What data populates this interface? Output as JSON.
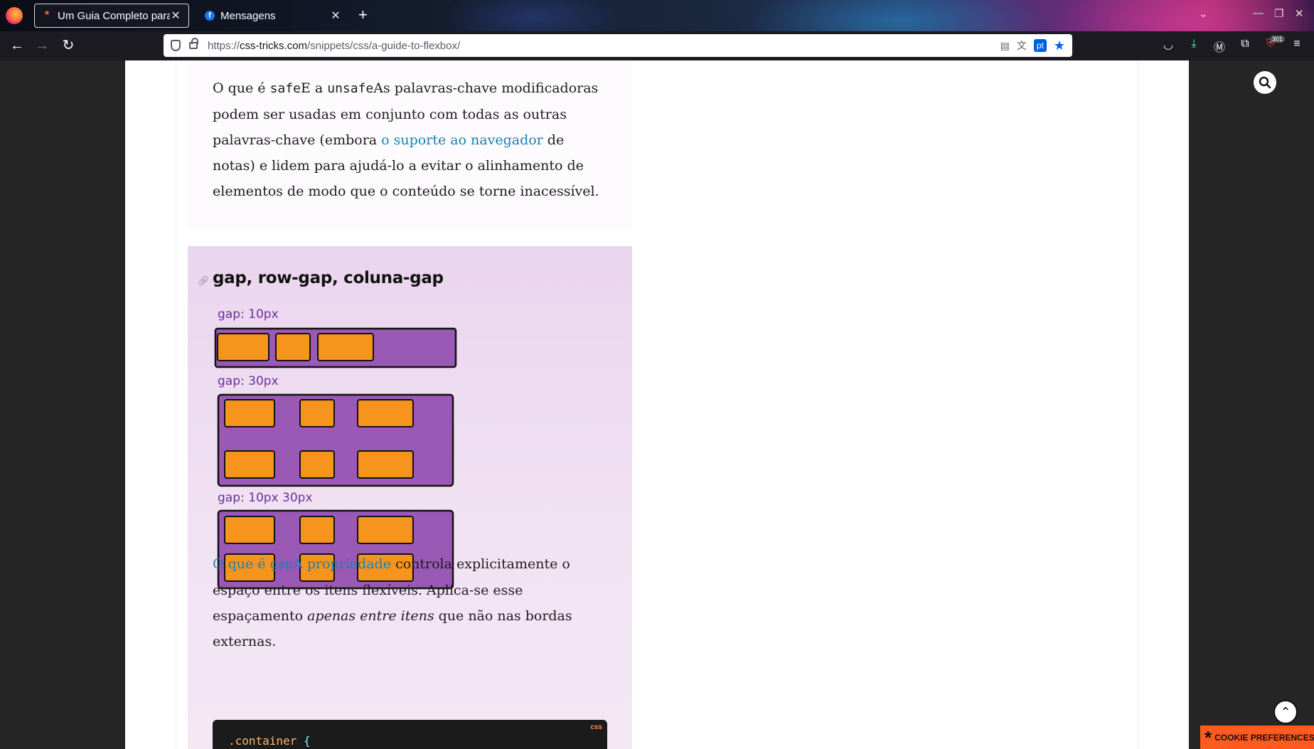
{
  "browser": {
    "tabs": [
      {
        "title": "Um Guia Completo para",
        "favicon": "css-tricks-asterisk-icon"
      },
      {
        "title": "Mensagens",
        "favicon": "facebook-icon"
      }
    ],
    "url": {
      "protocol": "https://",
      "host": "css-tricks.com",
      "path": "/snippets/css/a-guide-to-flexbox/"
    },
    "translate_lang": "pt",
    "extension_badge": "301"
  },
  "article": {
    "p1": {
      "t1": "O que é ",
      "code1": "safe",
      "t2": "E a ",
      "code2": "unsafe",
      "t3": "As palavras-chave modificadoras podem ser usadas em conjunto com todas as outras palavras-chave (embora ",
      "link": "o suporte ao navegador",
      "t4": " de notas) e lidem para ajudá-lo a evitar o alinhamento de elementos de modo que o conteúdo se torne inacessível."
    },
    "heading": "gap, row-gap, coluna-gap",
    "diagram": {
      "labels": [
        "gap: 10px",
        "gap: 30px",
        "gap: 10px 30px"
      ],
      "container_color": "#9b59b6",
      "item_color": "#f7941d"
    },
    "p2": {
      "link1": "O que é ",
      "code": "gap",
      "link2": "A propriedade",
      "t1": " controla explicitamente o espaço entre os itens flexíveis. Aplica-se esse espaçamento ",
      "em": "apenas entre itens",
      "t2": " que não nas bordas externas."
    },
    "code": {
      "lang": "css",
      "selector": ".container",
      "brace": "{"
    }
  },
  "cookie_label": "COOKIE PREFERENCES"
}
